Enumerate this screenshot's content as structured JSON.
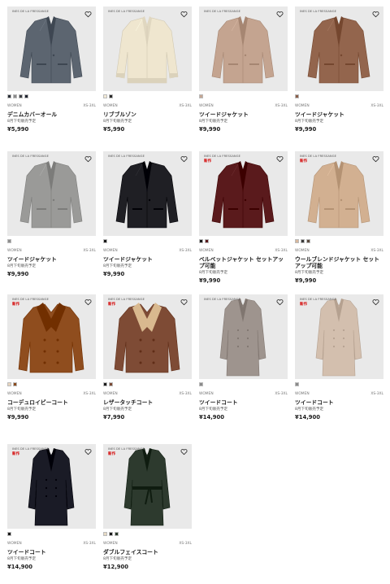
{
  "fav_icon": "heart-outline-icon",
  "products": [
    {
      "collab": "INES DE LA FRESSANGE",
      "badge": "",
      "name": "デニムカバーオール",
      "gender": "WOMEN",
      "sizes": "XS-3XL",
      "note": "8月下旬販売予定",
      "price": "¥5,990",
      "colors": [
        "#2a2f38",
        "#8a8a8a",
        "#3c3f44",
        "#1f2430"
      ],
      "garment_color": "#5c6570",
      "garment": "jacket"
    },
    {
      "collab": "INES DE LA FRESSANGE",
      "badge": "",
      "name": "リブブルゾン",
      "gender": "WOMEN",
      "sizes": "XS-3XL",
      "note": "8月下旬販売予定",
      "price": "¥5,990",
      "colors": [
        "#f2ead6",
        "#2a2a2a"
      ],
      "garment_color": "#efe6cf",
      "garment": "bomber"
    },
    {
      "collab": "INES DE LA FRESSANGE",
      "badge": "",
      "name": "ツイードジャケット",
      "gender": "WOMEN",
      "sizes": "XS-3XL",
      "note": "8月下旬販売予定",
      "price": "¥9,990",
      "colors": [
        "#c4a693"
      ],
      "garment_color": "#c4a490",
      "garment": "blazer"
    },
    {
      "collab": "INES DE LA FRESSANGE",
      "badge": "",
      "name": "ツイードジャケット",
      "gender": "WOMEN",
      "sizes": "XS-3XL",
      "note": "8月下旬販売予定",
      "price": "¥9,990",
      "colors": [
        "#8a5e48"
      ],
      "garment_color": "#93654d",
      "garment": "blazer"
    },
    {
      "collab": "INES DE LA FRESSANGE",
      "badge": "",
      "name": "ツイードジャケット",
      "gender": "WOMEN",
      "sizes": "XS-3XL",
      "note": "8月下旬販売予定",
      "price": "¥9,990",
      "colors": [
        "#8d8d8d"
      ],
      "garment_color": "#9a9a98",
      "garment": "blazer"
    },
    {
      "collab": "INES DE LA FRESSANGE",
      "badge": "",
      "name": "ツイードジャケット",
      "gender": "WOMEN",
      "sizes": "XS-3XL",
      "note": "8月下旬販売予定",
      "price": "¥9,990",
      "colors": [
        "#1a1a1a"
      ],
      "garment_color": "#1f1f24",
      "garment": "blazer"
    },
    {
      "collab": "INES DE LA FRESSANGE",
      "badge": "新作",
      "name": "ベルベットジャケット セットアップ可能",
      "gender": "WOMEN",
      "sizes": "XS-3XL",
      "note": "8月下旬販売予定",
      "price": "¥9,990",
      "colors": [
        "#1a1a1a",
        "#5a1a1c"
      ],
      "garment_color": "#5a1a1c",
      "garment": "blazer"
    },
    {
      "collab": "INES DE LA FRESSANGE",
      "badge": "新作",
      "name": "ウールブレンドジャケット セットアップ可能",
      "gender": "WOMEN",
      "sizes": "XS-3XL",
      "note": "8月下旬販売予定",
      "price": "¥9,990",
      "colors": [
        "#d8b79c",
        "#3a3a3a",
        "#5a4a3e"
      ],
      "garment_color": "#d2b091",
      "garment": "blazer"
    },
    {
      "collab": "INES DE LA FRESSANGE",
      "badge": "新作",
      "name": "コーデュロイピーコート",
      "gender": "WOMEN",
      "sizes": "XS-3XL",
      "note": "8月下旬販売予定",
      "price": "¥9,990",
      "colors": [
        "#e6d4bf",
        "#8a4a1c"
      ],
      "garment_color": "#8f4d1e",
      "garment": "peacoat"
    },
    {
      "collab": "INES DE LA FRESSANGE",
      "badge": "新作",
      "name": "レザータッチコート",
      "gender": "WOMEN",
      "sizes": "XS-3XL",
      "note": "8月下旬販売予定",
      "price": "¥7,990",
      "colors": [
        "#1a1a1a",
        "#7a4a34"
      ],
      "garment_color": "#7e4b35",
      "garment": "shearling"
    },
    {
      "collab": "INES DE LA FRESSANGE",
      "badge": "",
      "name": "ツイードコート",
      "gender": "WOMEN",
      "sizes": "XS-3XL",
      "note": "8月下旬販売予定",
      "price": "¥14,900",
      "colors": [
        "#8a8a8a"
      ],
      "garment_color": "#9e948e",
      "garment": "longcoat"
    },
    {
      "collab": "INES DE LA FRESSANGE",
      "badge": "新作",
      "name": "ツイードコート",
      "gender": "WOMEN",
      "sizes": "XS-3XL",
      "note": "8月下旬販売予定",
      "price": "¥14,900",
      "colors": [
        "#8a8a8a"
      ],
      "garment_color": "#d3bfae",
      "garment": "longcoat"
    },
    {
      "collab": "INES DE LA FRESSANGE",
      "badge": "新作",
      "name": "ツイードコート",
      "gender": "WOMEN",
      "sizes": "XS-3XL",
      "note": "8月下旬販売予定",
      "price": "¥14,900",
      "colors": [
        "#1a1a1a"
      ],
      "garment_color": "#1a1b26",
      "garment": "longcoat"
    },
    {
      "collab": "INES DE LA FRESSANGE",
      "badge": "新作",
      "name": "ダブルフェイスコート",
      "gender": "WOMEN",
      "sizes": "XS-3XL",
      "note": "8月下旬販売予定",
      "price": "¥12,900",
      "colors": [
        "#e6d9c3",
        "#1a1a1a",
        "#2a3a2a"
      ],
      "garment_color": "#2d3a2e",
      "garment": "wrapcoat"
    }
  ]
}
